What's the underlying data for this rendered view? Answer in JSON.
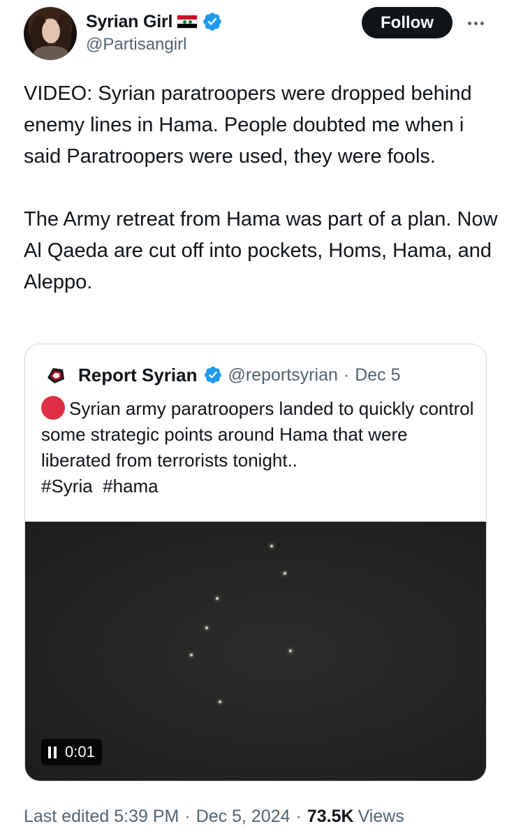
{
  "author": {
    "display_name": "Syrian Girl",
    "handle": "@Partisangirl"
  },
  "follow_label": "Follow",
  "tweet_text": "VIDEO: Syrian paratroopers were dropped behind enemy lines in Hama. People doubted me when i said Paratroopers were used, they were fools.\n\nThe Army retreat from Hama was part of a plan. Now Al Qaeda are cut off into pockets, Homs, Hama, and Aleppo.",
  "quote": {
    "display_name": "Report Syrian",
    "handle": "@reportsyrian",
    "separator": "·",
    "date": "Dec 5",
    "text": "Syrian army paratroopers landed to quickly control some strategic points around Hama that were liberated from terrorists tonight..",
    "hashtags": "#Syria  #hama",
    "video_time": "0:01"
  },
  "meta": {
    "edited": "Last edited 5:39 PM",
    "separator": "·",
    "date": "Dec 5, 2024",
    "views_count": "73.5K",
    "views_label": "Views"
  },
  "colors": {
    "text_primary": "#0f1419",
    "text_secondary": "#536471",
    "verified_blue": "#1d9bf0",
    "border": "#cfd9de",
    "follow_bg": "#0f1419"
  },
  "icons": [
    "verified-badge-icon",
    "syria-flag-icon",
    "more-icon",
    "red-circle-emoji",
    "pause-icon"
  ]
}
